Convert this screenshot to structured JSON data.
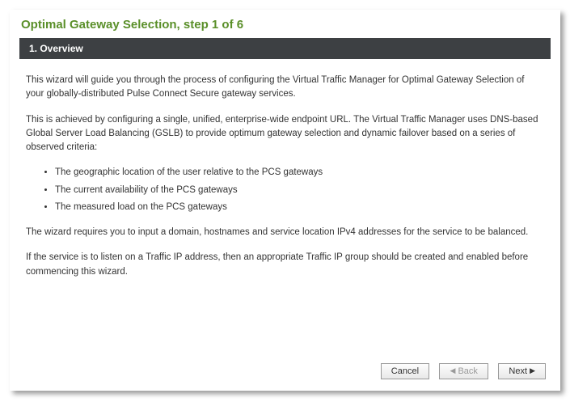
{
  "title": "Optimal Gateway Selection, step 1 of 6",
  "section_header": "1. Overview",
  "paragraphs": {
    "p1": "This wizard will guide you through the process of configuring the Virtual Traffic Manager for Optimal Gateway Selection of your globally-distributed Pulse Connect Secure gateway services.",
    "p2": "This is achieved by configuring a single, unified, enterprise-wide endpoint URL. The Virtual Traffic Manager uses DNS-based Global Server Load Balancing (GSLB) to provide optimum gateway selection and dynamic failover based on a series of observed criteria:",
    "p3": "The wizard requires you to input a domain, hostnames and service location IPv4 addresses for the service to be balanced.",
    "p4": "If the service is to listen on a Traffic IP address, then an appropriate Traffic IP group should be created and enabled before commencing this wizard."
  },
  "criteria": [
    "The geographic location of the user relative to the PCS gateways",
    "The current availability of the PCS gateways",
    "The measured load on the PCS gateways"
  ],
  "buttons": {
    "cancel": "Cancel",
    "back": "Back",
    "next": "Next"
  }
}
